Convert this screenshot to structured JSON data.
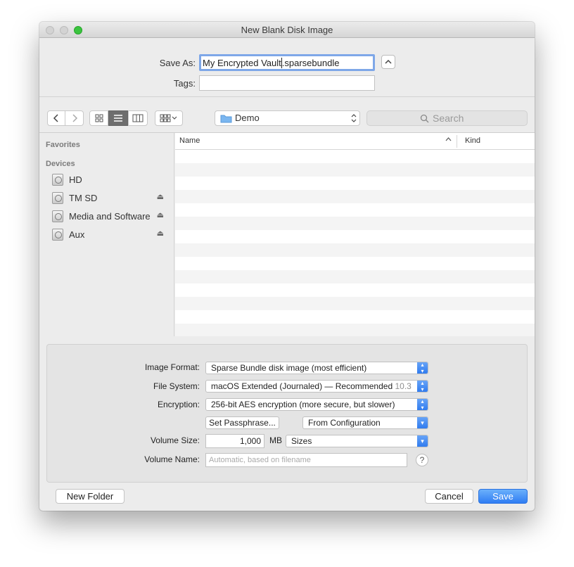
{
  "window": {
    "title": "New Blank Disk Image"
  },
  "save_panel": {
    "save_as_label": "Save As:",
    "save_as_value_before_caret": "My Encrypted Vault",
    "save_as_value_after_caret": ".sparsebundle",
    "tags_label": "Tags:",
    "tags_value": ""
  },
  "toolbar": {
    "back": "‹",
    "forward": "›",
    "location": "Demo",
    "search_placeholder": "Search",
    "view_mode": "list"
  },
  "sidebar": {
    "favorites_header": "Favorites",
    "devices_header": "Devices",
    "devices": [
      {
        "label": "HD",
        "eject": false
      },
      {
        "label": "TM SD",
        "eject": true
      },
      {
        "label": "Media and Software",
        "eject": true
      },
      {
        "label": "Aux",
        "eject": true
      }
    ]
  },
  "file_list": {
    "columns": [
      "Name",
      "Kind"
    ],
    "rows": []
  },
  "options": {
    "image_format_label": "Image Format:",
    "image_format_value": "Sparse Bundle disk image (most efficient)",
    "file_system_label": "File System:",
    "file_system_value": "macOS Extended (Journaled) — Recommended",
    "file_system_hint": "10.3",
    "encryption_label": "Encryption:",
    "encryption_value": "256-bit AES encryption (more secure, but slower)",
    "set_passphrase_label": "Set Passphrase...",
    "passphrase_source_value": "From Configuration",
    "volume_size_label": "Volume Size:",
    "volume_size_value": "1,000",
    "volume_size_unit": "MB",
    "sizes_value": "Sizes",
    "volume_name_label": "Volume Name:",
    "volume_name_placeholder": "Automatic, based on filename",
    "help": "?"
  },
  "footer": {
    "new_folder_label": "New Folder",
    "cancel_label": "Cancel",
    "save_label": "Save"
  },
  "colors": {
    "accent": "#2f7df3",
    "close_zoom_green": "#3bc43f"
  }
}
